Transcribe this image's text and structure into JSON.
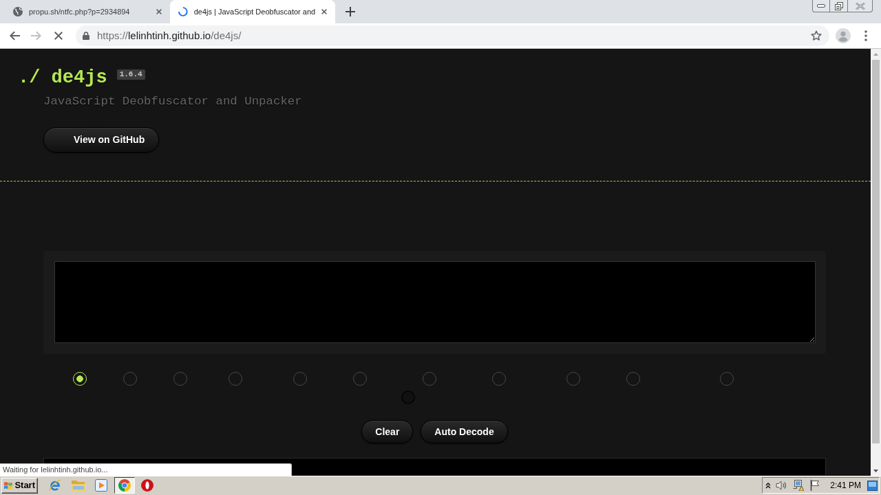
{
  "browser": {
    "tabs": [
      {
        "title": "propu.sh/ntfc.php?p=2934894",
        "selected": false,
        "loading": false
      },
      {
        "title": "de4js | JavaScript Deobfuscator and",
        "selected": true,
        "loading": true
      }
    ],
    "nav_buttons": [
      {
        "kind": "back",
        "disabled": false
      },
      {
        "kind": "forward",
        "disabled": true
      }
    ],
    "address": {
      "scheme": "https://",
      "host": "lelinhtinh.github.io",
      "path": "/de4js/"
    },
    "status_text": "Waiting for lelinhtinh.github.io..."
  },
  "page": {
    "logo": "./ de4js",
    "version": "1.6.4",
    "tagline": "JavaScript Deobfuscator and Unpacker",
    "github_button": "View on GitHub",
    "methods": [
      {
        "selected": true,
        "disabled": false
      },
      {
        "selected": false,
        "disabled": false
      },
      {
        "selected": false,
        "disabled": false
      },
      {
        "selected": false,
        "disabled": false
      },
      {
        "selected": false,
        "disabled": false
      },
      {
        "selected": false,
        "disabled": false
      },
      {
        "selected": false,
        "disabled": false
      },
      {
        "selected": false,
        "disabled": false
      },
      {
        "selected": false,
        "disabled": false
      },
      {
        "selected": false,
        "disabled": false
      },
      {
        "selected": false,
        "disabled": false
      },
      {
        "selected": false,
        "disabled": true
      }
    ],
    "buttons": [
      "Clear",
      "Auto Decode"
    ]
  },
  "taskbar": {
    "start": "Start",
    "apps": [
      {
        "kind": "e_logo",
        "selected": false
      },
      {
        "kind": "folder",
        "selected": false
      },
      {
        "kind": "media",
        "selected": false
      },
      {
        "kind": "wheel",
        "selected": true
      },
      {
        "kind": "ring",
        "selected": false
      }
    ],
    "clock": "2:41 PM"
  }
}
